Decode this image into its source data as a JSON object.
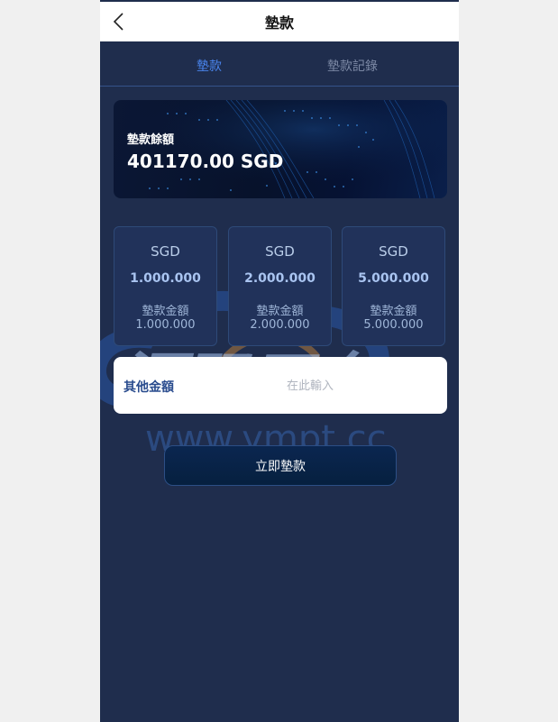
{
  "navbar": {
    "title": "墊款"
  },
  "tabs": [
    {
      "label": "墊款",
      "active": true
    },
    {
      "label": "墊款記錄",
      "active": false
    }
  ],
  "balance": {
    "label": "墊款餘額",
    "value": "401170.00 SGD"
  },
  "amounts": [
    {
      "currency": "SGD",
      "amount": "1.000.000",
      "label": "墊款金額",
      "sub": "1.000.000"
    },
    {
      "currency": "SGD",
      "amount": "2.000.000",
      "label": "墊款金額",
      "sub": "2.000.000"
    },
    {
      "currency": "SGD",
      "amount": "5.000.000",
      "label": "墊款金額",
      "sub": "5.000.000"
    }
  ],
  "other": {
    "label": "其他金額",
    "placeholder": "在此輸入"
  },
  "submit": {
    "label": "立即墊款"
  },
  "watermark": {
    "text": "源码平台",
    "url": "www.ympt.cc"
  },
  "colors": {
    "page_bg": "#1f2d4d",
    "accent": "#4a86f0",
    "card_border": "#2e4a78"
  }
}
